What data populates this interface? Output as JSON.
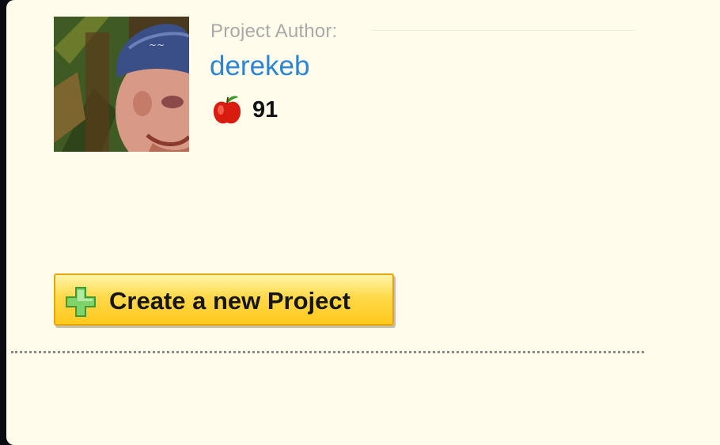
{
  "author": {
    "label": "Project Author:",
    "username": "derekeb",
    "apple_count": "91",
    "avatar_icon": "user-photo",
    "score_icon": "apple-icon"
  },
  "actions": {
    "create_project_label": "Create a new Project",
    "create_icon": "plus-icon"
  },
  "colors": {
    "background": "#fffcec",
    "link": "#2a86d4",
    "button": "#ffd94a",
    "button_border": "#e3a510"
  }
}
